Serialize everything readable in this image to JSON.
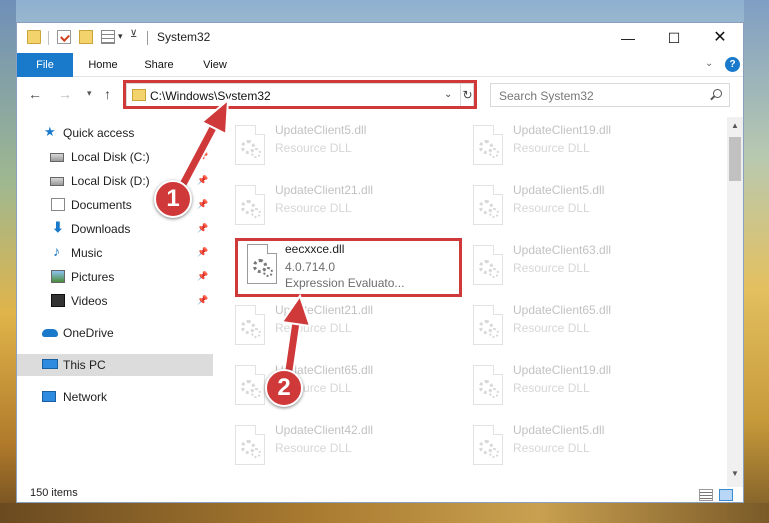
{
  "window": {
    "title": "System32",
    "minimize_glyph": "—",
    "maximize_glyph": "☐",
    "close_glyph": "✕"
  },
  "ribbon": {
    "tabs": [
      "File",
      "Home",
      "Share",
      "View"
    ],
    "expand_glyph": "⌄",
    "help_glyph": "?"
  },
  "navigation": {
    "address": "C:\\Windows\\System32",
    "search_placeholder": "Search System32"
  },
  "sidebar": {
    "items": [
      {
        "label": "Quick access",
        "icon": "star-icon",
        "pinned": false
      },
      {
        "label": "Local Disk (C:)",
        "icon": "drive-icon",
        "pinned": true
      },
      {
        "label": "Local Disk (D:)",
        "icon": "drive-icon",
        "pinned": true
      },
      {
        "label": "Documents",
        "icon": "documents-icon",
        "pinned": true
      },
      {
        "label": "Downloads",
        "icon": "downloads-icon",
        "pinned": true
      },
      {
        "label": "Music",
        "icon": "music-icon",
        "pinned": true
      },
      {
        "label": "Pictures",
        "icon": "pictures-icon",
        "pinned": true
      },
      {
        "label": "Videos",
        "icon": "videos-icon",
        "pinned": true
      },
      {
        "label": "OneDrive",
        "icon": "onedrive-icon",
        "pinned": false
      },
      {
        "label": "This PC",
        "icon": "computer-icon",
        "pinned": false,
        "selected": true
      },
      {
        "label": "Network",
        "icon": "network-icon",
        "pinned": false
      }
    ]
  },
  "files": {
    "left_column": [
      {
        "name": "UpdateClient5.dll",
        "type": "Resource DLL"
      },
      {
        "name": "UpdateClient21.dll",
        "type": "Resource DLL"
      },
      {
        "name": "eecxxce.dll",
        "version": "4.0.714.0",
        "description": "Expression Evaluato..."
      },
      {
        "name": "UpdateClient21.dll",
        "type": "Resource DLL"
      },
      {
        "name": "UpdateClient65.dll",
        "type": "Resource DLL"
      },
      {
        "name": "UpdateClient42.dll",
        "type": "Resource DLL"
      }
    ],
    "right_column": [
      {
        "name": "UpdateClient19.dll",
        "type": "Resource DLL"
      },
      {
        "name": "UpdateClient5.dll",
        "type": "Resource DLL"
      },
      {
        "name": "UpdateClient63.dll",
        "type": "Resource DLL"
      },
      {
        "name": "UpdateClient65.dll",
        "type": "Resource DLL"
      },
      {
        "name": "UpdateClient19.dll",
        "type": "Resource DLL"
      },
      {
        "name": "UpdateClient5.dll",
        "type": "Resource DLL"
      }
    ]
  },
  "status": {
    "item_count": "150 items"
  },
  "annotations": {
    "step_1": "1",
    "step_2": "2",
    "highlight_color": "#d0393a"
  },
  "colors": {
    "accent": "#1979ca",
    "selected_sidebar": "#dcdcdc"
  }
}
